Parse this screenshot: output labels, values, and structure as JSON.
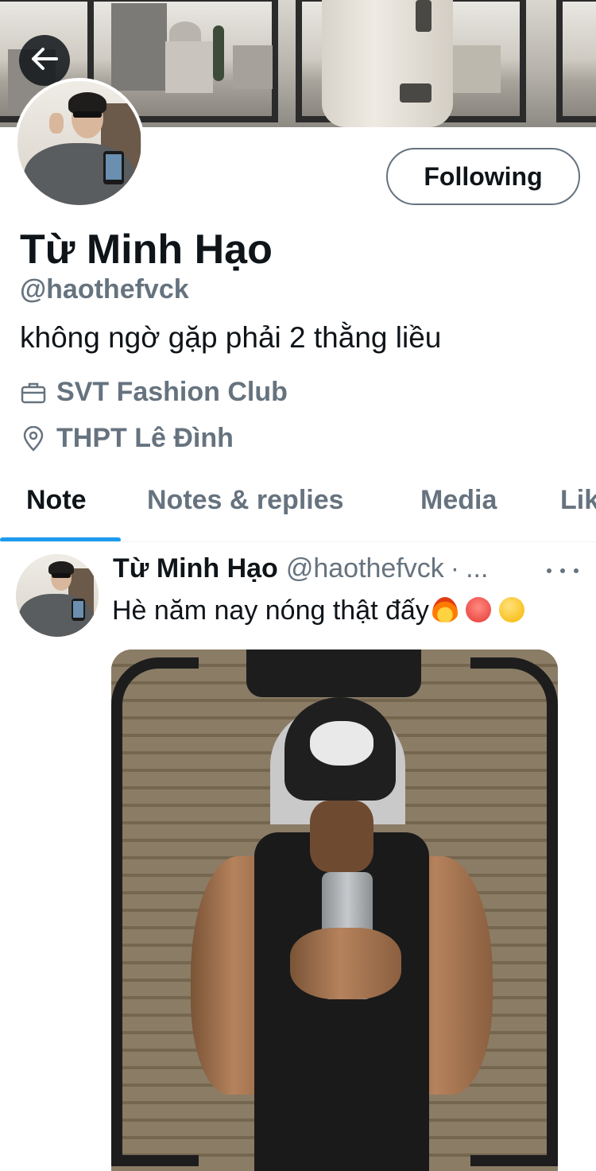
{
  "profile": {
    "display_name": "Từ Minh Hạo",
    "handle": "@haothefvck",
    "bio": "không ngờ gặp phải 2 thằng liều",
    "work": "SVT Fashion Club",
    "location": "THPT Lê Đình",
    "follow_label": "Following"
  },
  "icons": {
    "back": "arrow-left-icon",
    "work": "briefcase-icon",
    "location": "location-pin-icon",
    "more": "more-horizontal-icon"
  },
  "tabs": [
    {
      "label": "Note",
      "active": true
    },
    {
      "label": "Notes & replies",
      "active": false
    },
    {
      "label": "Media",
      "active": false
    },
    {
      "label": "Likes",
      "active": false
    }
  ],
  "post": {
    "author_name": "Từ Minh Hạo",
    "author_handle": "@haothefvck",
    "separator": "·",
    "time": "...",
    "text": "Hè năm nay nóng thật đấy",
    "emojis": [
      "fire",
      "hot-face",
      "winking-face"
    ]
  },
  "colors": {
    "text_primary": "#0f1419",
    "text_secondary": "#66737f",
    "accent": "#1d9bf0"
  }
}
